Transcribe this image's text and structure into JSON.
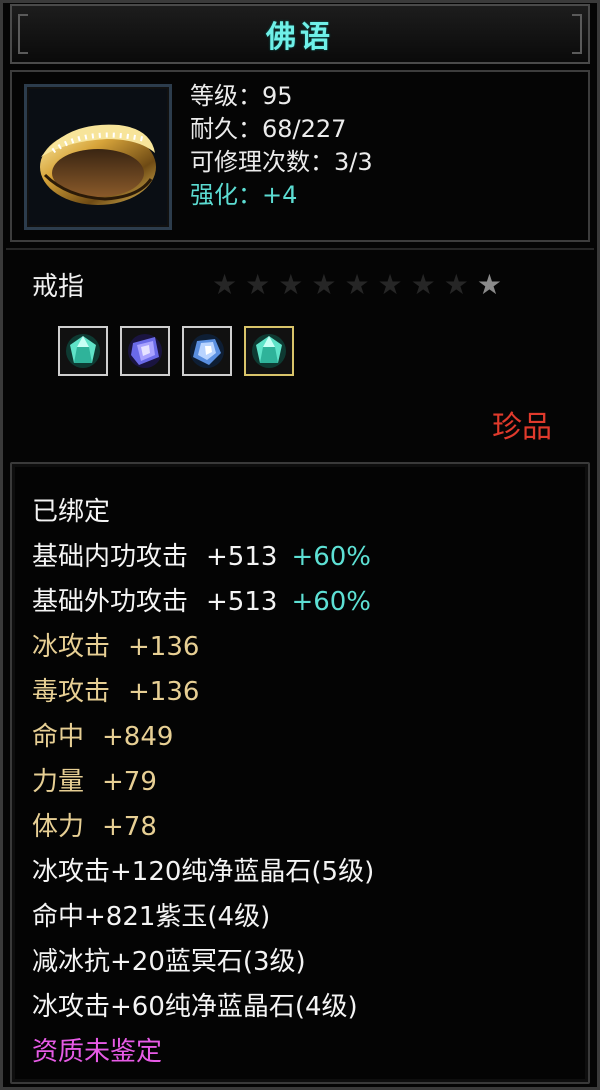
{
  "title": "佛语",
  "item": {
    "icon": "gold-ring-icon",
    "stats": [
      {
        "text": "等级：95",
        "color": "white"
      },
      {
        "text": "耐久：68/227",
        "color": "white"
      },
      {
        "text": "可修理次数：3/3",
        "color": "white"
      },
      {
        "text": "强化：+4",
        "color": "cyan"
      }
    ],
    "type": "戒指",
    "stars": {
      "total": 9,
      "lit": 1
    },
    "gems": [
      {
        "icon": "teal-gem-icon"
      },
      {
        "icon": "purple-gem-icon"
      },
      {
        "icon": "blue-gem-icon"
      },
      {
        "icon": "teal-gem-icon"
      }
    ],
    "rarity": "珍品"
  },
  "attributes": [
    {
      "name": "已绑定",
      "value": "",
      "pct": ""
    },
    {
      "name": "基础内功攻击",
      "value": "+513",
      "pct": "+60%"
    },
    {
      "name": "基础外功攻击",
      "value": "+513",
      "pct": "+60%"
    },
    {
      "name": "冰攻击",
      "value": "+136",
      "pct": ""
    },
    {
      "name": "毒攻击",
      "value": "+136",
      "pct": ""
    },
    {
      "name": "命中",
      "value": "+849",
      "pct": ""
    },
    {
      "name": "力量",
      "value": "+79",
      "pct": ""
    },
    {
      "name": "体力",
      "value": "+78",
      "pct": ""
    },
    {
      "name": "冰攻击+120纯净蓝晶石(5级)",
      "value": "",
      "pct": ""
    },
    {
      "name": "命中+821紫玉(4级)",
      "value": "",
      "pct": ""
    },
    {
      "name": "减冰抗+20蓝冥石(3级)",
      "value": "",
      "pct": ""
    },
    {
      "name": "冰攻击+60纯净蓝晶石(4级)",
      "value": "",
      "pct": ""
    },
    {
      "name": "资质未鉴定",
      "value": "",
      "pct": ""
    }
  ],
  "colors": {
    "title": "#6ff0e8",
    "cyan": "#5cdcd2",
    "gold_text": "#e7cf94",
    "rarity_red": "#e03a2c",
    "pink": "#e75be6"
  }
}
